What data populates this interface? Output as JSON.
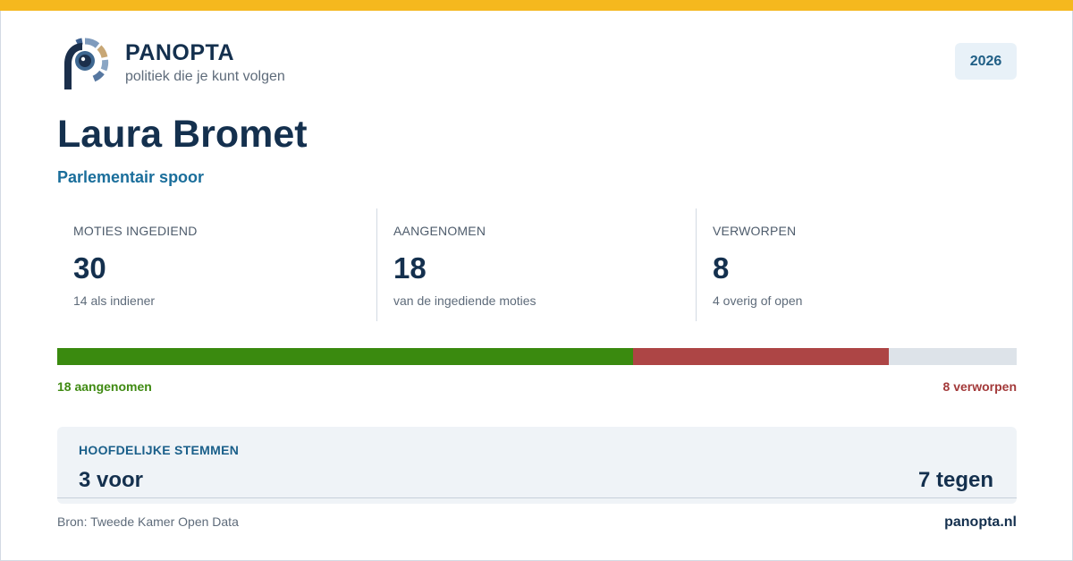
{
  "brand": {
    "name": "PANOPTA",
    "tagline": "politiek die je kunt volgen",
    "logo_icon": "panopta-eye-logo-icon"
  },
  "year_badge": "2026",
  "person": {
    "name": "Laura Bromet",
    "track": "Parlementair spoor"
  },
  "stats": [
    {
      "label": "MOTIES INGEDIEND",
      "value": "30",
      "sub": "14 als indiener"
    },
    {
      "label": "AANGENOMEN",
      "value": "18",
      "sub": "van de ingediende moties"
    },
    {
      "label": "VERWORPEN",
      "value": "8",
      "sub": "4 overig of open"
    }
  ],
  "progress": {
    "total": 30,
    "accepted": 18,
    "rejected": 8,
    "accepted_label": "18 aangenomen",
    "rejected_label": "8 verworpen",
    "colors": {
      "accepted": "#3a8a0f",
      "rejected": "#ad4545",
      "remainder": "#dde3e9"
    }
  },
  "votes": {
    "title": "HOOFDELIJKE STEMMEN",
    "for": "3 voor",
    "against": "7 tegen"
  },
  "footer": {
    "source": "Bron: Tweede Kamer Open Data",
    "site": "panopta.nl"
  },
  "colors": {
    "accent_stripe": "#f5b81e",
    "navy": "#14304e",
    "link_blue": "#1a6e9b"
  }
}
